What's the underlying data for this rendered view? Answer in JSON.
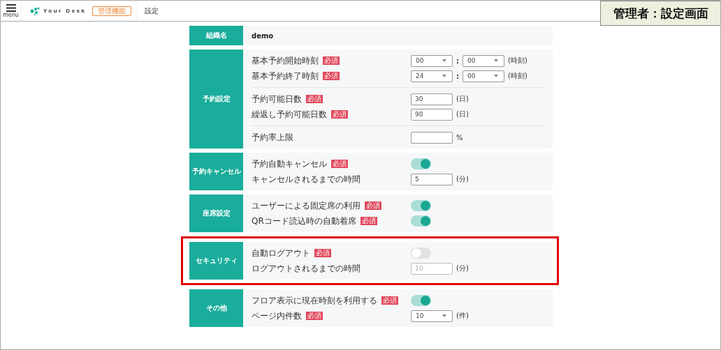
{
  "header": {
    "menu_label": "menu",
    "logo_text": "Your Desk",
    "badge": "管理機能",
    "page_title": "設定"
  },
  "caption": "管理者：設定画面",
  "sections": [
    {
      "title": "組織名",
      "highlighted": false,
      "value": "demo"
    },
    {
      "title": "予約設定",
      "highlighted": false,
      "groups": [
        [
          {
            "kind": "time",
            "label": "基本予約開始時刻",
            "badge": "必須",
            "hour": "00",
            "separator": ":",
            "minute": "00",
            "unit": "(時刻)"
          },
          {
            "kind": "time",
            "label": "基本予約終了時刻",
            "badge": "必須",
            "hour": "24",
            "separator": ":",
            "minute": "00",
            "unit": "(時刻)"
          }
        ],
        [
          {
            "kind": "text",
            "label": "予約可能日数",
            "badge": "必須",
            "value": "30",
            "unit": "(日)",
            "disabled": false
          },
          {
            "kind": "text",
            "label": "繰返し予約可能日数",
            "badge": "必須",
            "value": "90",
            "unit": "(日)",
            "disabled": false
          }
        ],
        [
          {
            "kind": "text",
            "label": "予約率上限",
            "unit": "%",
            "disabled": false
          }
        ]
      ]
    },
    {
      "title": "予約キャンセル",
      "highlighted": false,
      "groups": [
        [
          {
            "kind": "toggle",
            "label": "予約自動キャンセル",
            "badge": "必須",
            "on": true
          },
          {
            "kind": "text",
            "label": "キャンセルされるまでの時間",
            "value": "5",
            "unit": "(分)",
            "disabled": false
          }
        ]
      ]
    },
    {
      "title": "座席設定",
      "highlighted": false,
      "groups": [
        [
          {
            "kind": "toggle",
            "label": "ユーザーによる固定席の利用",
            "badge": "必須",
            "on": true
          },
          {
            "kind": "toggle",
            "label": "QRコード読込時の自動着席",
            "badge": "必須",
            "on": true
          }
        ]
      ]
    },
    {
      "title": "セキュリティ",
      "highlighted": true,
      "groups": [
        [
          {
            "kind": "toggle",
            "label": "自動ログアウト",
            "badge": "必須",
            "on": false
          },
          {
            "kind": "text",
            "label": "ログアウトされるまでの時間",
            "value": "10",
            "unit": "(分)",
            "disabled": true
          }
        ]
      ]
    },
    {
      "title": "その他",
      "highlighted": false,
      "groups": [
        [
          {
            "kind": "toggle",
            "label": "フロア表示に現在時刻を利用する",
            "badge": "必須",
            "on": true
          },
          {
            "kind": "select",
            "label": "ページ内件数",
            "badge": "必須",
            "value": "10",
            "unit": "(件)"
          }
        ]
      ]
    }
  ]
}
